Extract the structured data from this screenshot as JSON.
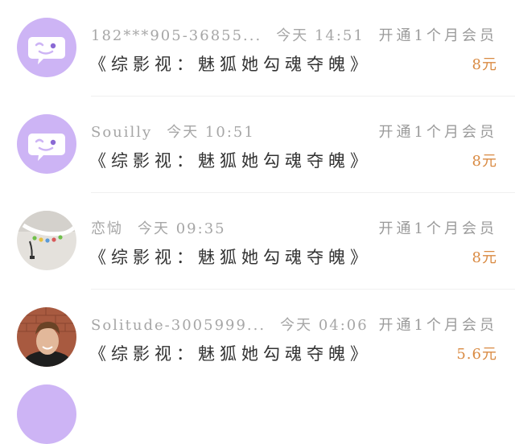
{
  "records": [
    {
      "user": "182***905-36855...",
      "time": "今天 14:51",
      "title": "《综影视：魅狐她勾魂夺魄》",
      "action": "开通1个月会员",
      "price": "8元",
      "avatar_icon": "chat-bubble-icon"
    },
    {
      "user": "Souilly",
      "time": "今天 10:51",
      "title": "《综影视：魅狐她勾魂夺魄》",
      "action": "开通1个月会员",
      "price": "8元",
      "avatar_icon": "chat-bubble-icon"
    },
    {
      "user": "恋恸",
      "time": "今天 09:35",
      "title": "《综影视：魅狐她勾魂夺魄》",
      "action": "开通1个月会员",
      "price": "8元",
      "avatar_icon": "photo-avatar"
    },
    {
      "user": "Solitude-3005999...",
      "time": "今天 04:06",
      "title": "《综影视：魅狐她勾魂夺魄》",
      "action": "开通1个月会员",
      "price": "5.6元",
      "avatar_icon": "photo-avatar"
    }
  ],
  "colors": {
    "default_avatar": "#cdb4f5",
    "price": "#d98a42",
    "meta_text": "#a6a6a6"
  }
}
